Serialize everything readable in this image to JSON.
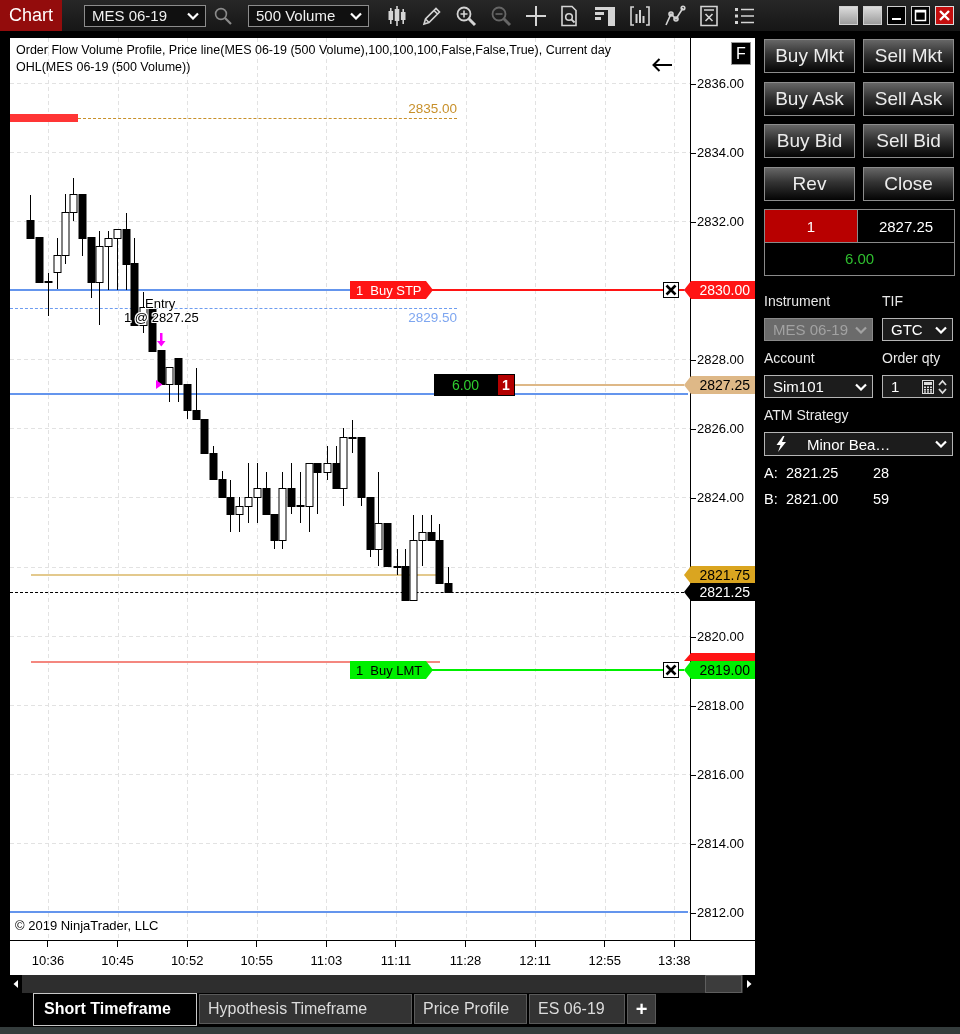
{
  "toolbar": {
    "title": "Chart",
    "instrument": "MES 06-19",
    "interval": "500 Volume",
    "tools": [
      {
        "kind": "candles",
        "disabled": false
      },
      {
        "kind": "pencil",
        "disabled": false
      },
      {
        "kind": "zoom-in",
        "disabled": false
      },
      {
        "kind": "zoom-out",
        "disabled": true
      },
      {
        "kind": "crosshair",
        "disabled": false
      },
      {
        "kind": "doc-search",
        "disabled": false
      },
      {
        "kind": "panels",
        "disabled": false
      },
      {
        "kind": "bars",
        "disabled": false
      },
      {
        "kind": "nodes",
        "disabled": false
      },
      {
        "kind": "doc",
        "disabled": false
      },
      {
        "kind": "list",
        "disabled": false
      }
    ]
  },
  "chart": {
    "indicator_label": "Order Flow Volume Profile, Price line(MES 06-19 (500 Volume),100,100,100,False,False,True), Current day OHL(MES 06-19 (500 Volume))",
    "format_button": "F",
    "plot_levels": [
      {
        "kind": "high",
        "label": "2835.00"
      },
      {
        "kind": "prior",
        "label": "2829.50"
      }
    ],
    "orders": [
      {
        "kind": "stop",
        "quantity": "1",
        "type": "Buy STP",
        "price": "2830.00"
      },
      {
        "kind": "limit",
        "quantity": "1",
        "type": "Buy LMT",
        "price": "2819.00"
      }
    ],
    "position": {
      "pnl": "6.00",
      "quantity": "1",
      "price": "2827.25"
    },
    "execution": {
      "label": "Entry",
      "detail": "1 @ 2827.25"
    },
    "price_markers": [
      {
        "kind": "open",
        "label": "2821.75"
      },
      {
        "kind": "last",
        "label": "2821.25"
      }
    ],
    "price_ticks": [
      "2836.00",
      "2834.00",
      "2832.00",
      "2828.00",
      "2826.00",
      "2824.00",
      "2820.00",
      "2818.00",
      "2816.00",
      "2814.00",
      "2812.00"
    ],
    "time_labels": [
      "10:36",
      "10:45",
      "10:52",
      "10:55",
      "11:03",
      "11:11",
      "11:28",
      "12:11",
      "12:55",
      "13:38"
    ],
    "copyright": "© 2019 NinjaTrader, LLC"
  },
  "tabs": [
    {
      "label": "Short Timeframe",
      "selected": true
    },
    {
      "label": "Hypothesis Timeframe",
      "selected": false
    },
    {
      "label": "Price Profile",
      "selected": false
    },
    {
      "label": "ES 06-19",
      "selected": false
    }
  ],
  "add_tab": "+",
  "order_panel": {
    "buttons": [
      "Buy Mkt",
      "Sell Mkt",
      "Buy Ask",
      "Sell Ask",
      "Buy Bid",
      "Sell Bid",
      "Rev",
      "Close"
    ],
    "position": {
      "quantity": "1",
      "avg_price": "2827.25",
      "pnl": "6.00"
    },
    "instrument": {
      "label": "Instrument",
      "value": "MES 06-19",
      "disabled": true
    },
    "tif": {
      "label": "TIF",
      "value": "GTC",
      "disabled": false
    },
    "account": {
      "label": "Account",
      "value": "Sim101",
      "disabled": false
    },
    "order_qty": {
      "label": "Order qty",
      "value": "1"
    },
    "atm_strategy": {
      "label": "ATM Strategy",
      "value": "Minor Bea…"
    },
    "quotes": [
      {
        "side": "A:",
        "price": "2821.25",
        "size": "28"
      },
      {
        "side": "B:",
        "price": "2821.00",
        "size": "59"
      }
    ]
  }
}
